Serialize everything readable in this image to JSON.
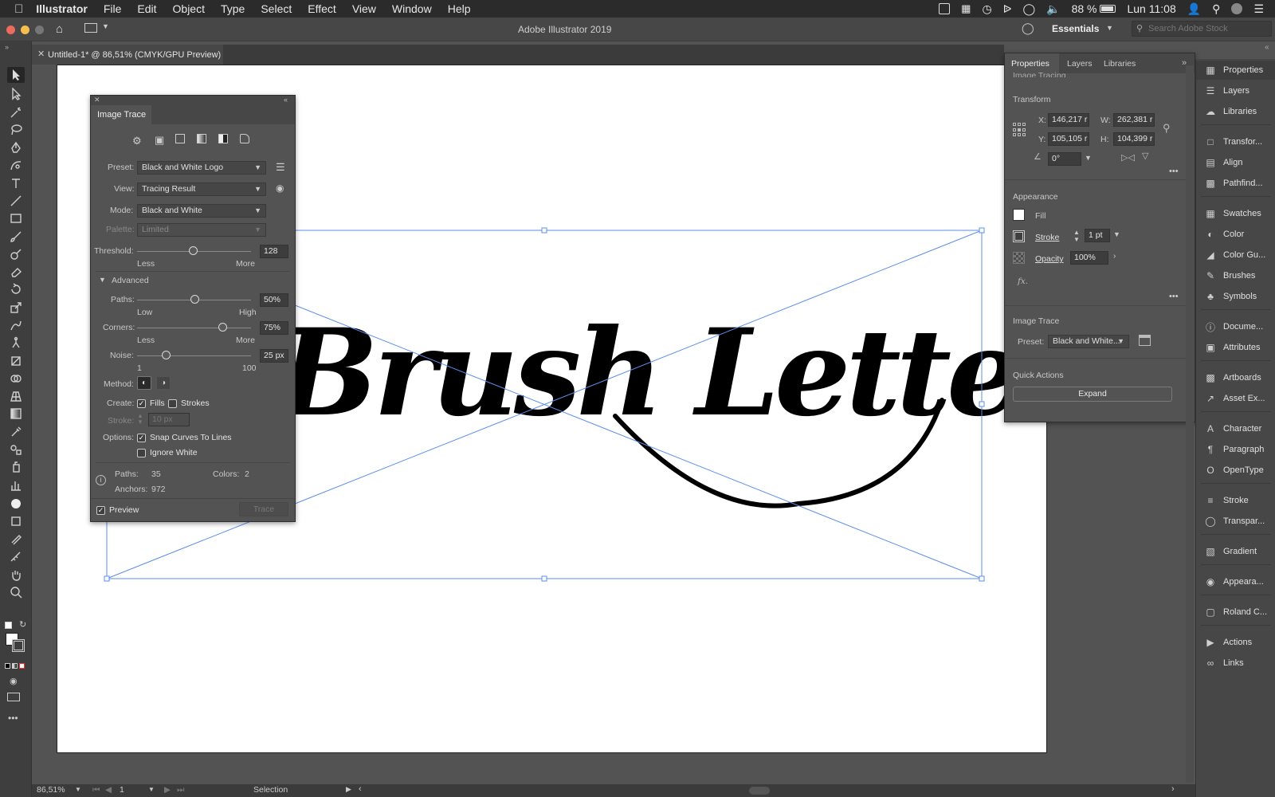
{
  "menubar": {
    "app_name": "Illustrator",
    "items": [
      "File",
      "Edit",
      "Object",
      "Type",
      "Select",
      "Effect",
      "View",
      "Window",
      "Help"
    ],
    "battery": "88 %",
    "clock": "Lun 11:08"
  },
  "appbar": {
    "window_title": "Adobe Illustrator 2019",
    "workspace": "Essentials",
    "search_placeholder": "Search Adobe Stock"
  },
  "document": {
    "tab_title": "Untitled-1* @ 86,51% (CMYK/GPU Preview)",
    "artwork_text": "Brush Lettering"
  },
  "image_trace_panel": {
    "title": "Image Trace",
    "preset_label": "Preset:",
    "preset_value": "Black and White Logo",
    "view_label": "View:",
    "view_value": "Tracing Result",
    "mode_label": "Mode:",
    "mode_value": "Black and White",
    "palette_label": "Palette:",
    "palette_value": "Limited",
    "threshold_label": "Threshold:",
    "threshold_value": "128",
    "threshold_less": "Less",
    "threshold_more": "More",
    "threshold_fraction": 0.49,
    "advanced_label": "Advanced",
    "paths_label": "Paths:",
    "paths_value": "50%",
    "paths_low": "Low",
    "paths_high": "High",
    "paths_fraction": 0.5,
    "corners_label": "Corners:",
    "corners_value": "75%",
    "corners_less": "Less",
    "corners_more": "More",
    "corners_fraction": 0.75,
    "noise_label": "Noise:",
    "noise_value": "25 px",
    "noise_min": "1",
    "noise_max": "100",
    "noise_fraction": 0.25,
    "method_label": "Method:",
    "create_label": "Create:",
    "fills_label": "Fills",
    "strokes_label": "Strokes",
    "stroke_label": "Stroke:",
    "stroke_value": "10 px",
    "options_label": "Options:",
    "snap_label": "Snap Curves To Lines",
    "ignore_white_label": "Ignore White",
    "stats_paths_label": "Paths:",
    "stats_paths_value": "35",
    "stats_colors_label": "Colors:",
    "stats_colors_value": "2",
    "stats_anchors_label": "Anchors:",
    "stats_anchors_value": "972",
    "preview_label": "Preview",
    "trace_button": "Trace"
  },
  "properties_panel": {
    "tabs": [
      "Properties",
      "Layers",
      "Libraries"
    ],
    "cut_section": "Image Tracing",
    "transform_title": "Transform",
    "x_label": "X:",
    "x_value": "146,217 r",
    "y_label": "Y:",
    "y_value": "105,105 r",
    "w_label": "W:",
    "w_value": "262,381 r",
    "h_label": "H:",
    "h_value": "104,399 r",
    "angle_value": "0°",
    "appearance_title": "Appearance",
    "fill_label": "Fill",
    "stroke_label": "Stroke",
    "stroke_weight": "1 pt",
    "opacity_label": "Opacity",
    "opacity_value": "100%",
    "fx_label": "fx.",
    "image_trace_title": "Image Trace",
    "preset_label": "Preset:",
    "preset_value": "Black and White...",
    "quick_actions_title": "Quick Actions",
    "expand_button": "Expand"
  },
  "dock": [
    {
      "label": "Properties",
      "icon": "properties-icon"
    },
    {
      "label": "Layers",
      "icon": "layers-icon"
    },
    {
      "label": "Libraries",
      "icon": "libraries-icon"
    },
    {
      "label": "Transfor...",
      "icon": "transform-icon"
    },
    {
      "label": "Align",
      "icon": "align-icon"
    },
    {
      "label": "Pathfind...",
      "icon": "pathfinder-icon"
    },
    {
      "label": "Swatches",
      "icon": "swatches-icon"
    },
    {
      "label": "Color",
      "icon": "color-icon"
    },
    {
      "label": "Color Gu...",
      "icon": "color-guide-icon"
    },
    {
      "label": "Brushes",
      "icon": "brushes-icon"
    },
    {
      "label": "Symbols",
      "icon": "symbols-icon"
    },
    {
      "label": "Docume...",
      "icon": "document-info-icon"
    },
    {
      "label": "Attributes",
      "icon": "attributes-icon"
    },
    {
      "label": "Artboards",
      "icon": "artboards-icon"
    },
    {
      "label": "Asset Ex...",
      "icon": "asset-export-icon"
    },
    {
      "label": "Character",
      "icon": "character-icon"
    },
    {
      "label": "Paragraph",
      "icon": "paragraph-icon"
    },
    {
      "label": "OpenType",
      "icon": "opentype-icon"
    },
    {
      "label": "Stroke",
      "icon": "stroke-icon"
    },
    {
      "label": "Transpar...",
      "icon": "transparency-icon"
    },
    {
      "label": "Gradient",
      "icon": "gradient-icon"
    },
    {
      "label": "Appeara...",
      "icon": "appearance-icon"
    },
    {
      "label": "Roland C...",
      "icon": "roland-icon"
    },
    {
      "label": "Actions",
      "icon": "actions-icon"
    },
    {
      "label": "Links",
      "icon": "links-icon"
    }
  ],
  "statusbar": {
    "zoom": "86,51%",
    "artboard_number": "1",
    "tool_name": "Selection"
  },
  "colors": {
    "selection_blue": "#5b8dee",
    "panel_bg": "#535353",
    "chrome_dark": "#2b2b2b"
  }
}
